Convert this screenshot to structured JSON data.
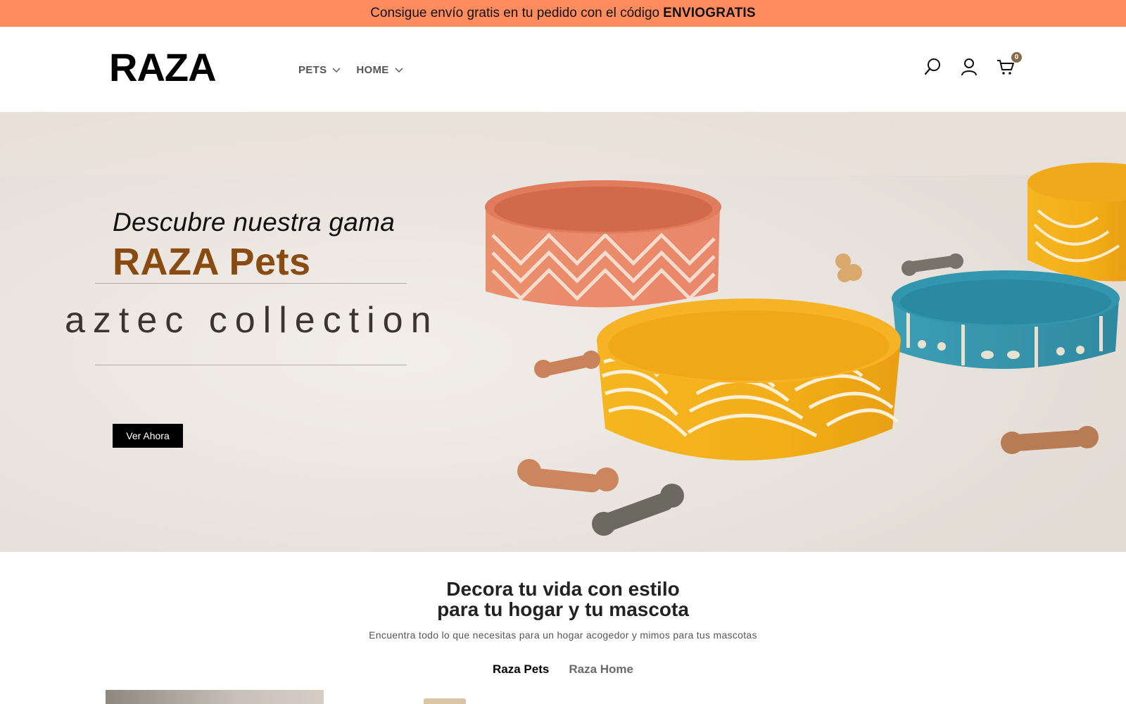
{
  "announcement": {
    "text": "Consigue envío gratis en tu pedido con el código",
    "code": "ENVIOGRATIS",
    "bg_color": "#ff8c5e"
  },
  "header": {
    "logo": "RAZA",
    "nav": [
      {
        "label": "PETS",
        "icon": "chevron-down-icon"
      },
      {
        "label": "HOME",
        "icon": "chevron-down-icon"
      }
    ],
    "icons": [
      "search-icon",
      "user-icon",
      "cart-icon"
    ],
    "cart_count": "0"
  },
  "hero": {
    "line1": "Descubre nuestra gama",
    "line2": "RAZA Pets",
    "line3": "aztec collection",
    "button": "Ver Ahora",
    "accent_color": "#8a4b10"
  },
  "section": {
    "title_line1": "Decora tu vida con estilo",
    "title_line2": "para tu hogar y tu mascota",
    "subtitle": "Encuentra todo lo que necesitas para un hogar acogedor y mimos para tus mascotas",
    "tabs": [
      {
        "label": "Raza Pets",
        "active": true
      },
      {
        "label": "Raza Home",
        "active": false
      }
    ]
  }
}
